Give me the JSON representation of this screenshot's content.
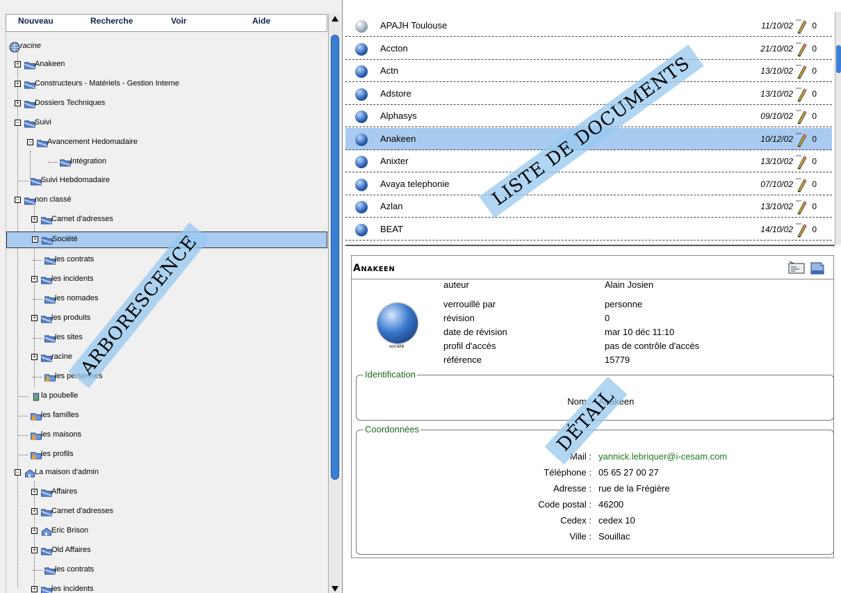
{
  "menu": [
    "Nouveau",
    "Recherche",
    "Voir",
    "Aide"
  ],
  "tree": {
    "root": "racine",
    "items": [
      "Anakeen",
      "Constructeurs - Matériels - Gestion Interne",
      "Dossiers Techniques",
      "Suivi",
      "Avancement Hedomadaire",
      "Intégration",
      "Suivi Hebdomadaire",
      "non classé",
      "Carnet d'adresses",
      "Société",
      "les contrats",
      "les incidents",
      "les nomades",
      "les produits",
      "les sites",
      "racine",
      "les personnes",
      "la poubelle",
      "les familles",
      "les maisons",
      "les profils",
      "La maison d'admin",
      "Affaires",
      "Carnet d'adresses",
      "Eric Brison",
      "Old Affaires",
      "les contrats",
      "les incidents"
    ]
  },
  "documents": [
    {
      "name": "APAJH Toulouse",
      "date": "11/10/02",
      "count": "0"
    },
    {
      "name": "Accton",
      "date": "21/10/02",
      "count": "0"
    },
    {
      "name": "Actn",
      "date": "13/10/02",
      "count": "0"
    },
    {
      "name": "Adstore",
      "date": "13/10/02",
      "count": "0"
    },
    {
      "name": "Alphasys",
      "date": "09/10/02",
      "count": "0"
    },
    {
      "name": "Anakeen",
      "date": "10/12/02",
      "count": "0"
    },
    {
      "name": "Anixter",
      "date": "13/10/02",
      "count": "0"
    },
    {
      "name": "Avaya telephonie",
      "date": "07/10/02",
      "count": "0"
    },
    {
      "name": "Azlan",
      "date": "13/10/02",
      "count": "0"
    },
    {
      "name": "BEAT",
      "date": "14/10/02",
      "count": "0"
    }
  ],
  "detail": {
    "title": "Anakeen",
    "icon_caption": "société",
    "meta": [
      {
        "label": "auteur",
        "value": "Alain Josien"
      },
      {
        "label": "verrouillé par",
        "value": "personne"
      },
      {
        "label": "révision",
        "value": "0"
      },
      {
        "label": "date de révision",
        "value": "mar 10 déc 11:10"
      },
      {
        "label": "profil d'accès",
        "value": "pas de contrôle d'accès"
      },
      {
        "label": "référence",
        "value": "15779"
      }
    ],
    "identification": {
      "legend": "Identification",
      "nom_label": "Nom :",
      "nom_value": "Anakeen"
    },
    "coordonnees": {
      "legend": "Coordonnées",
      "fields": [
        {
          "label": "Mail :",
          "value": "yannick.lebriquer@i-cesam.com"
        },
        {
          "label": "Téléphone :",
          "value": "05 65 27 00 27"
        },
        {
          "label": "Adresse :",
          "value": "rue de la Frégière"
        },
        {
          "label": "Code postal :",
          "value": "46200"
        },
        {
          "label": "Cedex :",
          "value": "cedex 10"
        },
        {
          "label": "Ville :",
          "value": "Souillac"
        }
      ]
    }
  },
  "annotations": {
    "tree": "ARBORESCENCE",
    "list": "LISTE  DE DOCUMENTS",
    "detail": "DÉTAIL"
  },
  "colors": {
    "selection": "#aacbf0",
    "scrollbar_thumb": "#3a7fd4",
    "link_green": "#1a7a1a",
    "annotation": "#96c8f0"
  }
}
